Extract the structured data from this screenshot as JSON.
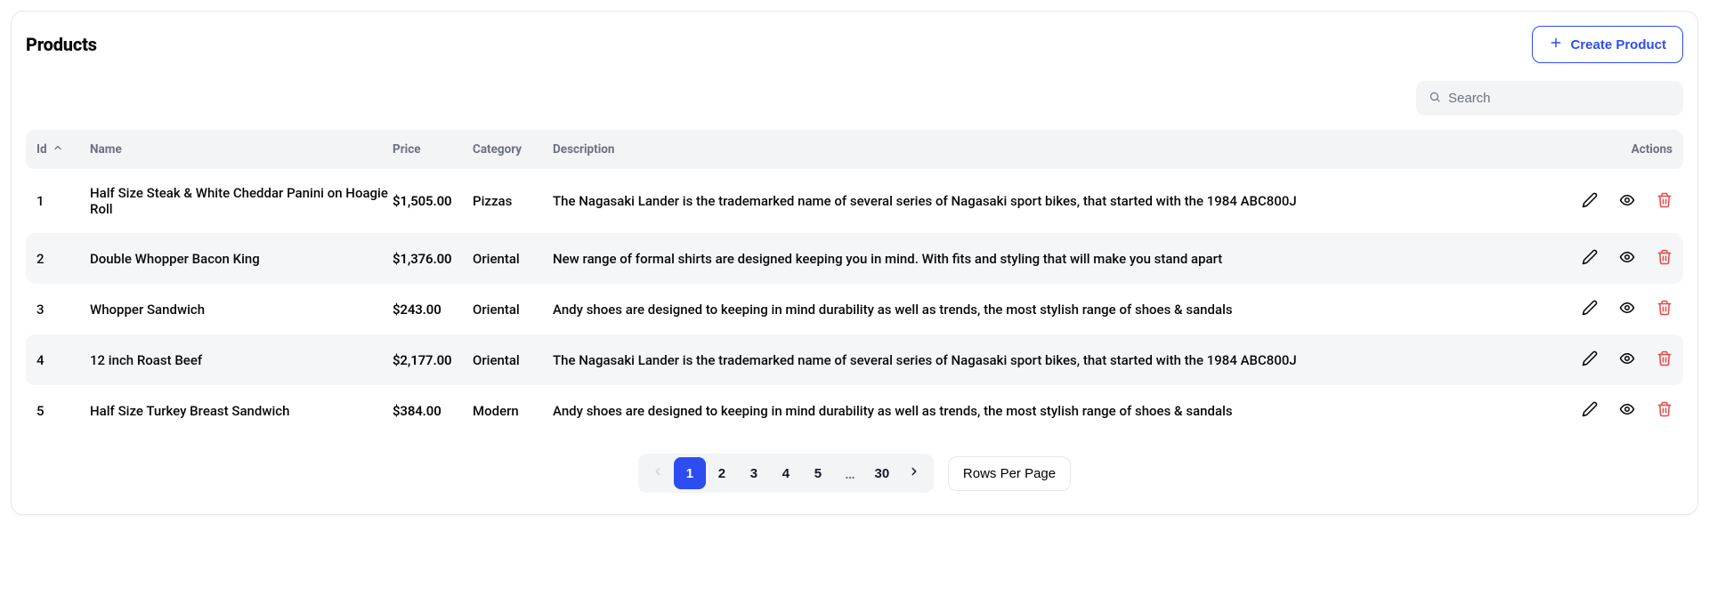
{
  "title": "Products",
  "create_button": "Create Product",
  "search": {
    "placeholder": "Search",
    "value": ""
  },
  "columns": {
    "id": "Id",
    "name": "Name",
    "price": "Price",
    "category": "Category",
    "description": "Description",
    "actions": "Actions"
  },
  "rows": [
    {
      "id": "1",
      "name": "Half Size Steak & White Cheddar Panini on Hoagie Roll",
      "price": "$1,505.00",
      "category": "Pizzas",
      "description": "The Nagasaki Lander is the trademarked name of several series of Nagasaki sport bikes, that started with the 1984 ABC800J"
    },
    {
      "id": "2",
      "name": "Double Whopper Bacon King",
      "price": "$1,376.00",
      "category": "Oriental",
      "description": "New range of formal shirts are designed keeping you in mind. With fits and styling that will make you stand apart"
    },
    {
      "id": "3",
      "name": "Whopper Sandwich",
      "price": "$243.00",
      "category": "Oriental",
      "description": "Andy shoes are designed to keeping in mind durability as well as trends, the most stylish range of shoes & sandals"
    },
    {
      "id": "4",
      "name": "12 inch Roast Beef",
      "price": "$2,177.00",
      "category": "Oriental",
      "description": "The Nagasaki Lander is the trademarked name of several series of Nagasaki sport bikes, that started with the 1984 ABC800J"
    },
    {
      "id": "5",
      "name": "Half Size Turkey Breast Sandwich",
      "price": "$384.00",
      "category": "Modern",
      "description": "Andy shoes are designed to keeping in mind durability as well as trends, the most stylish range of shoes & sandals"
    }
  ],
  "pagination": {
    "pages": [
      "1",
      "2",
      "3",
      "4",
      "5"
    ],
    "ellipsis": "…",
    "last": "30",
    "current": "1",
    "rows_per_page_label": "Rows Per Page"
  }
}
